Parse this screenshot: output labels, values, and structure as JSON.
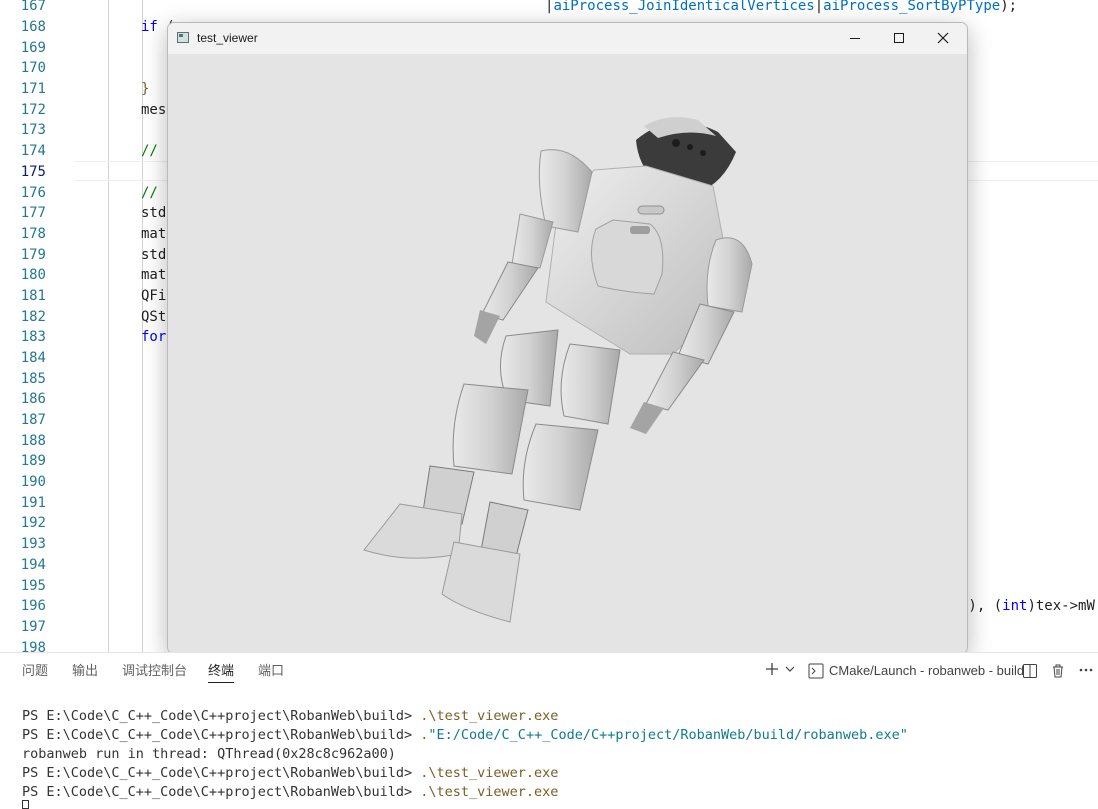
{
  "editor": {
    "line_numbers": [
      "167",
      "168",
      "169",
      "170",
      "171",
      "172",
      "173",
      "174",
      "175",
      "176",
      "177",
      "178",
      "179",
      "180",
      "181",
      "182",
      "183",
      "184",
      "185",
      "186",
      "187",
      "188",
      "189",
      "190",
      "191",
      "192",
      "193",
      "194",
      "195",
      "196",
      "197",
      "198"
    ],
    "current_line": "175",
    "code": {
      "l167_enum_a": "aiProcess_JoinIdenticalVertices",
      "l167_sep": "|",
      "l167_enum_b": "aiProcess_SortByPType",
      "l167_end": ");",
      "l168_kw": "if",
      "l168_rest": " (",
      "l171_brace": "}",
      "l172_text": "mes",
      "l174_comment": "//",
      "l176_comment": "//",
      "l177_text": "std",
      "l178_text": "mat",
      "l179_text": "std",
      "l180_text": "mat",
      "l181_text": "QFi",
      "l182_text": "QSt",
      "l183_kw": "for",
      "l196_a": "a), (",
      "l196_kw": "int",
      "l196_b": ")tex->mW"
    }
  },
  "window": {
    "title": "test_viewer",
    "icon": "qt-app-icon",
    "controls": [
      "minimize-icon",
      "maximize-icon",
      "close-icon"
    ]
  },
  "panel": {
    "tabs": [
      {
        "label": "问题"
      },
      {
        "label": "输出"
      },
      {
        "label": "调试控制台"
      },
      {
        "label": "终端",
        "active": true
      },
      {
        "label": "端口"
      }
    ],
    "terminal_label": "CMake/Launch - robanweb - build"
  },
  "terminal": {
    "prompt": "PS E:\\Code\\C_C++_Code\\C++project\\RobanWeb\\build> ",
    "lines": [
      {
        "cmd": ".\\test_viewer.exe"
      },
      {
        "cmd": ".",
        "str": "\"E:/Code/C_C++_Code/C++project/RobanWeb/build/robanweb.exe\""
      },
      {
        "output": "robanweb run in thread: QThread(0x28c8c962a00)"
      },
      {
        "cmd": ".\\test_viewer.exe"
      },
      {
        "cmd": ".\\test_viewer.exe"
      }
    ]
  },
  "colors": {
    "line_number": "#237893",
    "keyword": "#0000ff",
    "comment": "#008000",
    "enum": "#0070c1",
    "viewport_bg": "#e4e4e4"
  }
}
